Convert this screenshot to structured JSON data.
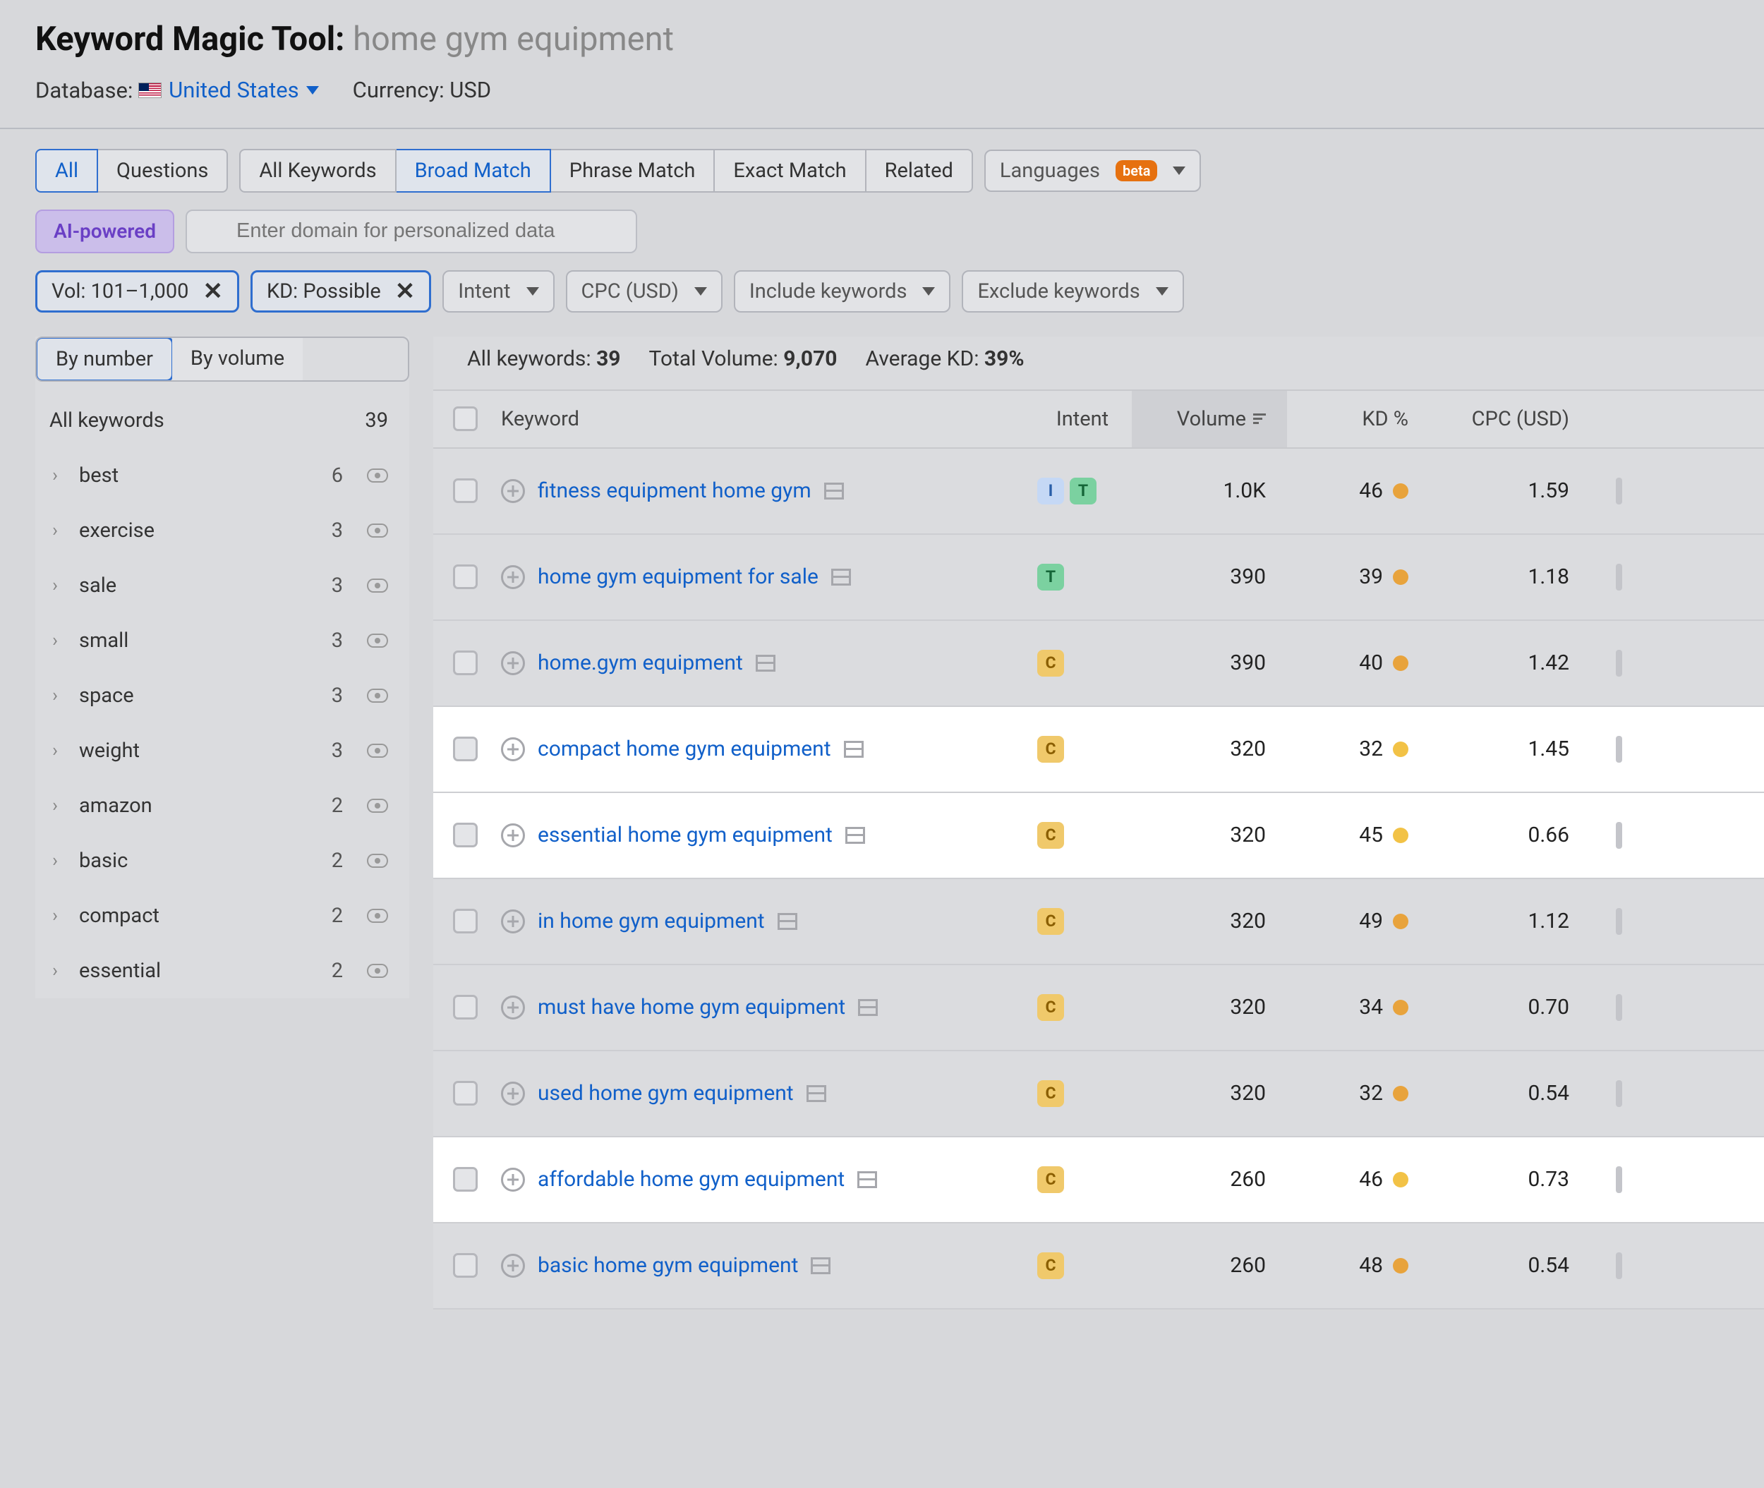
{
  "header": {
    "tool_name": "Keyword Magic Tool:",
    "query": "home gym equipment",
    "db_label": "Database:",
    "db_value": "United States",
    "currency_label": "Currency: USD"
  },
  "tabs_primary": {
    "all": "All",
    "questions": "Questions"
  },
  "tabs_match": {
    "all_keywords": "All Keywords",
    "broad": "Broad Match",
    "phrase": "Phrase Match",
    "exact": "Exact Match",
    "related": "Related"
  },
  "languages": {
    "label": "Languages",
    "badge": "beta"
  },
  "ai_row": {
    "pill": "AI-powered",
    "placeholder": "Enter domain for personalized data"
  },
  "filters": {
    "vol": "Vol: 101–1,000",
    "kd": "KD: Possible",
    "intent": "Intent",
    "cpc": "CPC (USD)",
    "include": "Include keywords",
    "exclude": "Exclude keywords"
  },
  "sidebar": {
    "by_number": "By number",
    "by_volume": "By volume",
    "all_label": "All keywords",
    "all_count": "39",
    "groups": [
      {
        "name": "best",
        "count": "6"
      },
      {
        "name": "exercise",
        "count": "3"
      },
      {
        "name": "sale",
        "count": "3"
      },
      {
        "name": "small",
        "count": "3"
      },
      {
        "name": "space",
        "count": "3"
      },
      {
        "name": "weight",
        "count": "3"
      },
      {
        "name": "amazon",
        "count": "2"
      },
      {
        "name": "basic",
        "count": "2"
      },
      {
        "name": "compact",
        "count": "2"
      },
      {
        "name": "essential",
        "count": "2"
      }
    ]
  },
  "summary": {
    "all_kw_label": "All keywords:",
    "all_kw_val": "39",
    "tot_vol_label": "Total Volume:",
    "tot_vol_val": "9,070",
    "avg_kd_label": "Average KD:",
    "avg_kd_val": "39%"
  },
  "columns": {
    "keyword": "Keyword",
    "intent": "Intent",
    "volume": "Volume",
    "kd": "KD %",
    "cpc": "CPC (USD)"
  },
  "rows": [
    {
      "kw": "fitness equipment home gym",
      "intents": [
        "I",
        "T"
      ],
      "vol": "1.0K",
      "kd": "46",
      "dot": "med",
      "cpc": "1.59",
      "hl": false
    },
    {
      "kw": "home gym equipment for sale",
      "intents": [
        "T"
      ],
      "vol": "390",
      "kd": "39",
      "dot": "med",
      "cpc": "1.18",
      "hl": false
    },
    {
      "kw": "home.gym equipment",
      "intents": [
        "C"
      ],
      "vol": "390",
      "kd": "40",
      "dot": "med",
      "cpc": "1.42",
      "hl": false
    },
    {
      "kw": "compact home gym equipment",
      "intents": [
        "C"
      ],
      "vol": "320",
      "kd": "32",
      "dot": "medlight",
      "cpc": "1.45",
      "hl": true
    },
    {
      "kw": "essential home gym equipment",
      "intents": [
        "C"
      ],
      "vol": "320",
      "kd": "45",
      "dot": "medlight",
      "cpc": "0.66",
      "hl": true
    },
    {
      "kw": "in home gym equipment",
      "intents": [
        "C"
      ],
      "vol": "320",
      "kd": "49",
      "dot": "med",
      "cpc": "1.12",
      "hl": false
    },
    {
      "kw": "must have home gym equipment",
      "intents": [
        "C"
      ],
      "vol": "320",
      "kd": "34",
      "dot": "med",
      "cpc": "0.70",
      "hl": false
    },
    {
      "kw": "used home gym equipment",
      "intents": [
        "C"
      ],
      "vol": "320",
      "kd": "32",
      "dot": "med",
      "cpc": "0.54",
      "hl": false
    },
    {
      "kw": "affordable home gym equipment",
      "intents": [
        "C"
      ],
      "vol": "260",
      "kd": "46",
      "dot": "medlight",
      "cpc": "0.73",
      "hl": true
    },
    {
      "kw": "basic home gym equipment",
      "intents": [
        "C"
      ],
      "vol": "260",
      "kd": "48",
      "dot": "med",
      "cpc": "0.54",
      "hl": false
    }
  ]
}
